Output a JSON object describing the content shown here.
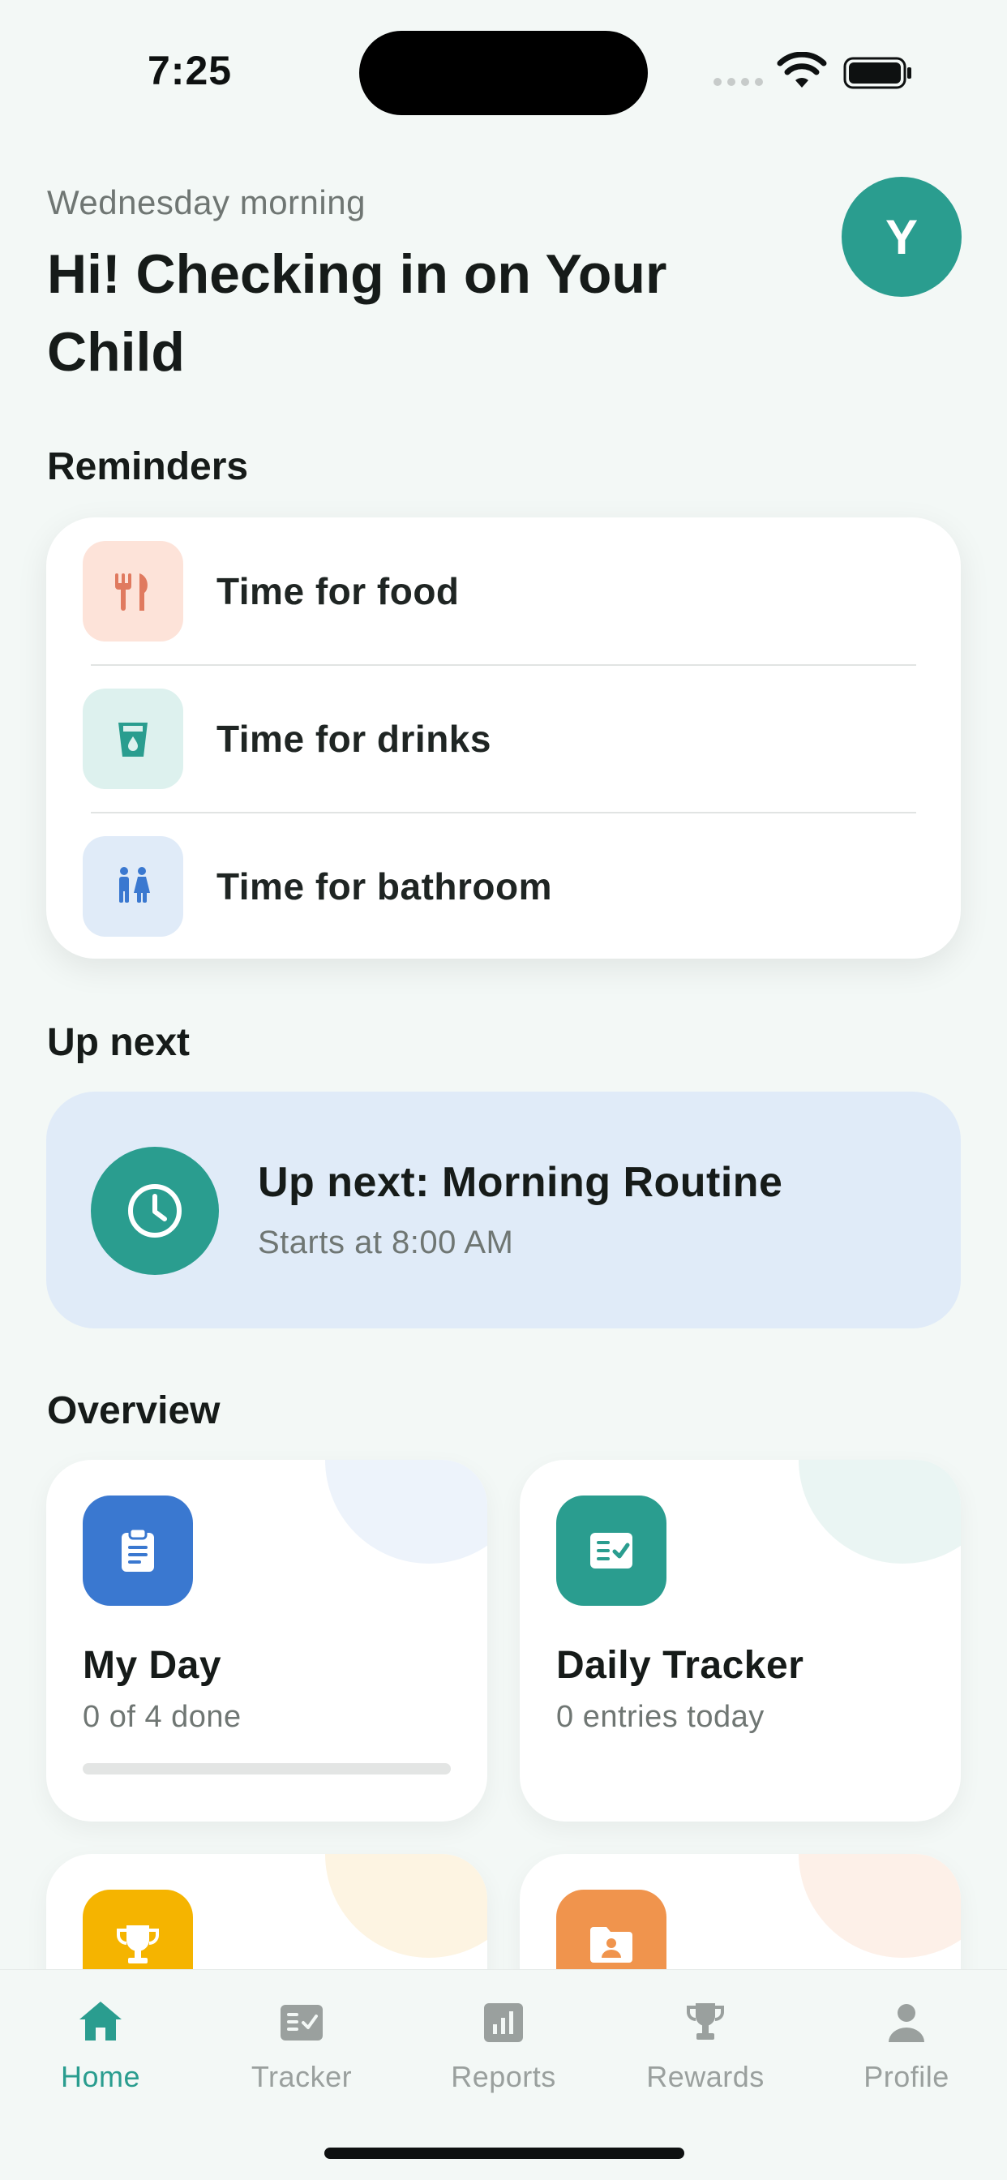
{
  "status_bar": {
    "time": "7:25"
  },
  "header": {
    "subtitle": "Wednesday morning",
    "title": "Hi! Checking in on Your Child",
    "avatar_initial": "Y"
  },
  "reminders": {
    "section_title": "Reminders",
    "items": [
      {
        "label": "Time for food",
        "icon": "fork-knife-icon",
        "color": "#e07a5f",
        "bg": "#fde3d9"
      },
      {
        "label": "Time for drinks",
        "icon": "cup-icon",
        "color": "#2a9d8f",
        "bg": "#ddf1ee"
      },
      {
        "label": "Time for bathroom",
        "icon": "restroom-icon",
        "color": "#3a78d0",
        "bg": "#e0ebf8"
      }
    ]
  },
  "up_next": {
    "section_title": "Up next",
    "title": "Up next: Morning Routine",
    "subtitle": "Starts at 8:00 AM"
  },
  "overview": {
    "section_title": "Overview",
    "cards": [
      {
        "title": "My Day",
        "subtitle": "0 of 4 done",
        "icon": "clipboard-icon",
        "color": "#3a78d0",
        "progress": 0
      },
      {
        "title": "Daily Tracker",
        "subtitle": "0 entries today",
        "icon": "checklist-icon",
        "color": "#2a9d8f"
      },
      {
        "icon": "trophy-icon",
        "color": "#f5b400"
      },
      {
        "icon": "folder-user-icon",
        "color": "#f0944d"
      }
    ]
  },
  "tabbar": {
    "tabs": [
      {
        "label": "Home",
        "icon": "home-icon",
        "active": true
      },
      {
        "label": "Tracker",
        "icon": "tracker-icon",
        "active": false
      },
      {
        "label": "Reports",
        "icon": "bar-chart-icon",
        "active": false
      },
      {
        "label": "Rewards",
        "icon": "trophy-icon",
        "active": false
      },
      {
        "label": "Profile",
        "icon": "person-icon",
        "active": false
      }
    ]
  },
  "colors": {
    "accent": "#2a9d8f",
    "background": "#f3f8f6"
  }
}
